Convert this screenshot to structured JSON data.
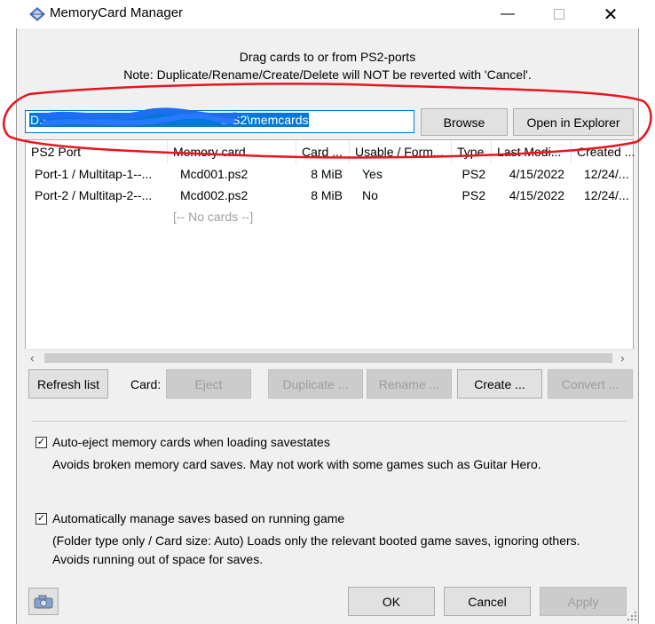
{
  "window": {
    "title": "MemoryCard Manager",
    "icon": "diamond-app-icon",
    "controls": [
      "minimize-icon",
      "maximize-icon",
      "close-icon"
    ]
  },
  "intro": {
    "line1": "Drag cards to or from PS2-ports",
    "line2": "Note: Duplicate/Rename/Create/Delete will NOT be reverted with 'Cancel'."
  },
  "path": {
    "prefix": "D:\\",
    "suffix": "\\PS2\\memcards",
    "browse_label": "Browse",
    "explorer_label": "Open in Explorer"
  },
  "table": {
    "headers": [
      "PS2 Port",
      "Memory card",
      "Card ...",
      "Usable / Form...",
      "Type",
      "Last Modi...",
      "Created ..."
    ],
    "rows": [
      [
        "Port-1 / Multitap-1--...",
        "Mcd001.ps2",
        "8 MiB",
        "Yes",
        "PS2",
        "4/15/2022",
        "12/24/..."
      ],
      [
        "Port-2 / Multitap-2--...",
        "Mcd002.ps2",
        "8 MiB",
        "No",
        "PS2",
        "4/15/2022",
        "12/24/..."
      ]
    ],
    "empty_row": "[-- No cards --]"
  },
  "card_actions": {
    "refresh_label": "Refresh list",
    "card_label": "Card:",
    "eject_label": "Eject",
    "duplicate_label": "Duplicate ...",
    "rename_label": "Rename ...",
    "create_label": "Create ...",
    "convert_label": "Convert ..."
  },
  "options": {
    "auto_eject": {
      "checked": true,
      "label": "Auto-eject memory cards when loading savestates",
      "description": "Avoids broken memory card saves. May not work with some games such as Guitar Hero."
    },
    "auto_manage": {
      "checked": true,
      "label": "Automatically manage saves based on running game",
      "description1": "(Folder type only / Card size: Auto) Loads only the relevant booted game saves, ignoring others.",
      "description2": "Avoids running out of space for saves."
    }
  },
  "footer": {
    "ok_label": "OK",
    "cancel_label": "Cancel",
    "apply_label": "Apply"
  },
  "colors": {
    "accent": "#0078d7",
    "annotation": "#e8141e",
    "scribble": "#1e6ef0"
  }
}
